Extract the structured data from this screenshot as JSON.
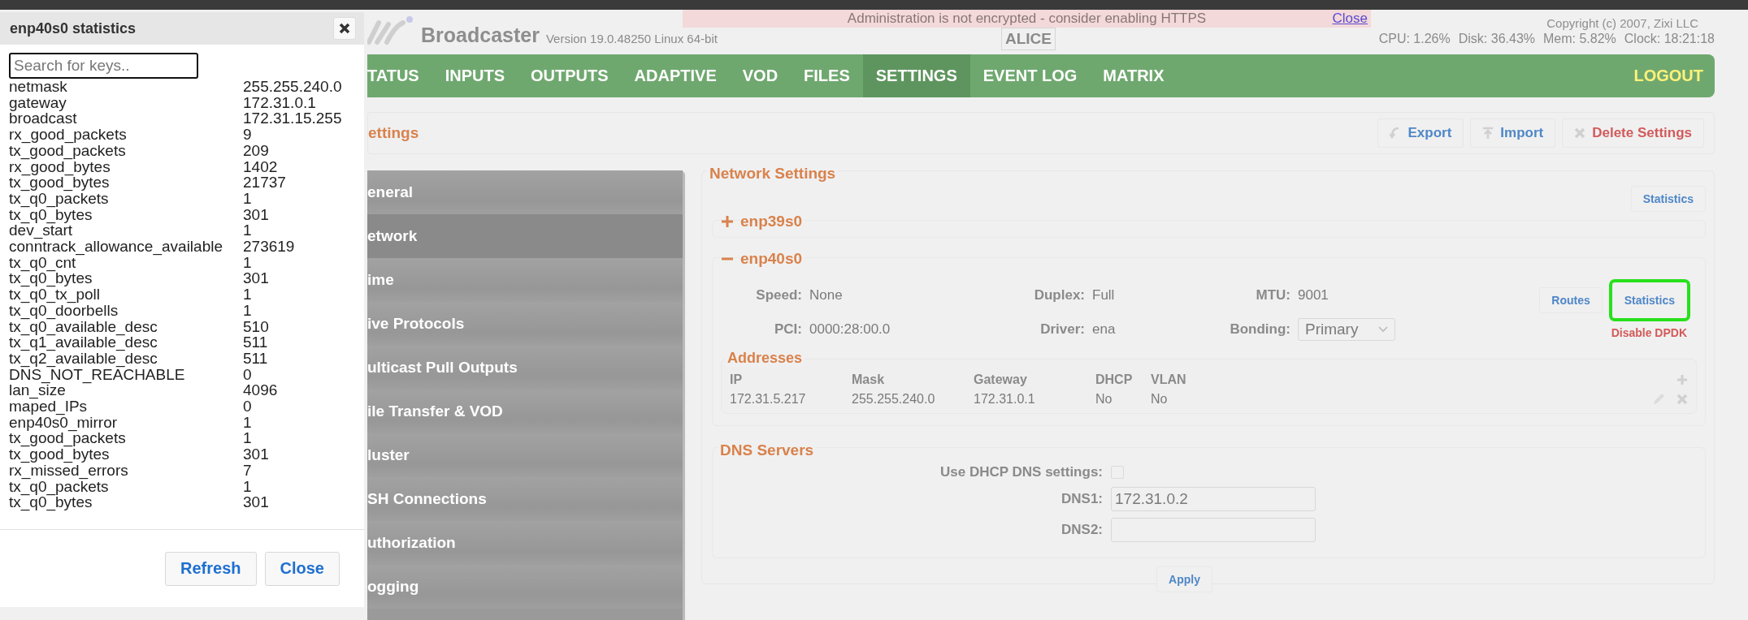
{
  "dialog": {
    "title": "enp40s0 statistics",
    "search": {
      "placeholder": "Search for keys.."
    },
    "rows": [
      {
        "key": "netmask",
        "value": "255.255.240.0"
      },
      {
        "key": "gateway",
        "value": "172.31.0.1"
      },
      {
        "key": "broadcast",
        "value": "172.31.15.255"
      },
      {
        "key": "rx_good_packets",
        "value": "9"
      },
      {
        "key": "tx_good_packets",
        "value": "209"
      },
      {
        "key": "rx_good_bytes",
        "value": "1402"
      },
      {
        "key": "tx_good_bytes",
        "value": "21737"
      },
      {
        "key": "tx_q0_packets",
        "value": "1"
      },
      {
        "key": "tx_q0_bytes",
        "value": "301"
      },
      {
        "key": "dev_start",
        "value": "1"
      },
      {
        "key": "conntrack_allowance_available",
        "value": "273619"
      },
      {
        "key": "tx_q0_cnt",
        "value": "1"
      },
      {
        "key": "tx_q0_bytes",
        "value": "301"
      },
      {
        "key": "tx_q0_tx_poll",
        "value": "1"
      },
      {
        "key": "tx_q0_doorbells",
        "value": "1"
      },
      {
        "key": "tx_q0_available_desc",
        "value": "510"
      },
      {
        "key": "tx_q1_available_desc",
        "value": "511"
      },
      {
        "key": "tx_q2_available_desc",
        "value": "511"
      },
      {
        "key": "DNS_NOT_REACHABLE",
        "value": "0"
      },
      {
        "key": "lan_size",
        "value": "4096"
      },
      {
        "key": "maped_IPs",
        "value": "0"
      },
      {
        "key": "enp40s0_mirror",
        "value": "1"
      },
      {
        "key": "tx_good_packets",
        "value": "1"
      },
      {
        "key": "tx_good_bytes",
        "value": "301"
      },
      {
        "key": "rx_missed_errors",
        "value": "7"
      },
      {
        "key": "tx_q0_packets",
        "value": "1"
      },
      {
        "key": "tx_q0_bytes",
        "value": "301"
      }
    ],
    "buttons": [
      "Refresh",
      "Close"
    ]
  },
  "header": {
    "product": "Broadcaster",
    "version": "Version 19.0.48250 Linux 64-bit",
    "alert": {
      "text": "Administration is not encrypted - consider enabling HTTPS",
      "link": "Close"
    },
    "hostname": "ALICE",
    "copyright": "Copyright (c) 2007, Zixi LLC",
    "stats": [
      "CPU: 1.26%",
      "Disk: 36.43%",
      "Mem: 5.82%",
      "Clock: 18:21:18"
    ]
  },
  "nav": {
    "items": [
      {
        "label": "TATUS",
        "selected": false
      },
      {
        "label": "INPUTS",
        "selected": false
      },
      {
        "label": "OUTPUTS",
        "selected": false
      },
      {
        "label": "ADAPTIVE",
        "selected": false
      },
      {
        "label": "VOD",
        "selected": false
      },
      {
        "label": "FILES",
        "selected": false
      },
      {
        "label": "SETTINGS",
        "selected": true
      },
      {
        "label": "EVENT LOG",
        "selected": false
      },
      {
        "label": "MATRIX",
        "selected": false
      }
    ],
    "logout": "LOGOUT"
  },
  "page_title": "ettings",
  "toolbar": [
    {
      "label": "Export",
      "kind": "export"
    },
    {
      "label": "Import",
      "kind": "import"
    },
    {
      "label": "Delete Settings",
      "kind": "delete"
    }
  ],
  "sidebar": {
    "items": [
      {
        "label": "eneral",
        "selected": false
      },
      {
        "label": "etwork",
        "selected": true
      },
      {
        "label": "ime",
        "selected": false
      },
      {
        "label": "ive Protocols",
        "selected": false
      },
      {
        "label": "ulticast Pull Outputs",
        "selected": false
      },
      {
        "label": "ile Transfer & VOD",
        "selected": false
      },
      {
        "label": "luster",
        "selected": false
      },
      {
        "label": "SH Connections",
        "selected": false
      },
      {
        "label": "uthorization",
        "selected": false
      },
      {
        "label": "ogging",
        "selected": false
      }
    ]
  },
  "network": {
    "legend": "Network Settings",
    "statistics_button": "Statistics",
    "interfaces": [
      {
        "name": "enp39s0",
        "expanded": false
      },
      {
        "name": "enp40s0",
        "expanded": true,
        "fields": [
          {
            "label": "Speed:",
            "value": "None"
          },
          {
            "label": "Duplex:",
            "value": "Full"
          },
          {
            "label": "MTU:",
            "value": "9001"
          },
          {
            "label": "PCI:",
            "value": "0000:28:00.0"
          },
          {
            "label": "Driver:",
            "value": "ena"
          }
        ],
        "bonding": {
          "label": "Bonding:",
          "value": "Primary"
        },
        "buttons": [
          {
            "label": "Routes",
            "highlighted": false
          },
          {
            "label": "Statistics",
            "highlighted": true
          }
        ],
        "dpdk_button": "Disable DPDK",
        "addresses": {
          "legend": "Addresses",
          "columns": [
            "IP",
            "Mask",
            "Gateway",
            "DHCP",
            "VLAN"
          ],
          "rows": [
            [
              "172.31.5.217",
              "255.255.240.0",
              "172.31.0.1",
              "No",
              "No"
            ]
          ]
        }
      }
    ],
    "dns": {
      "legend": "DNS Servers",
      "use_dhcp": {
        "label": "Use DHCP DNS settings:",
        "checked": false
      },
      "servers": [
        {
          "label": "DNS1:",
          "value": "172.31.0.2"
        },
        {
          "label": "DNS2:"
        }
      ],
      "apply": "Apply"
    }
  }
}
